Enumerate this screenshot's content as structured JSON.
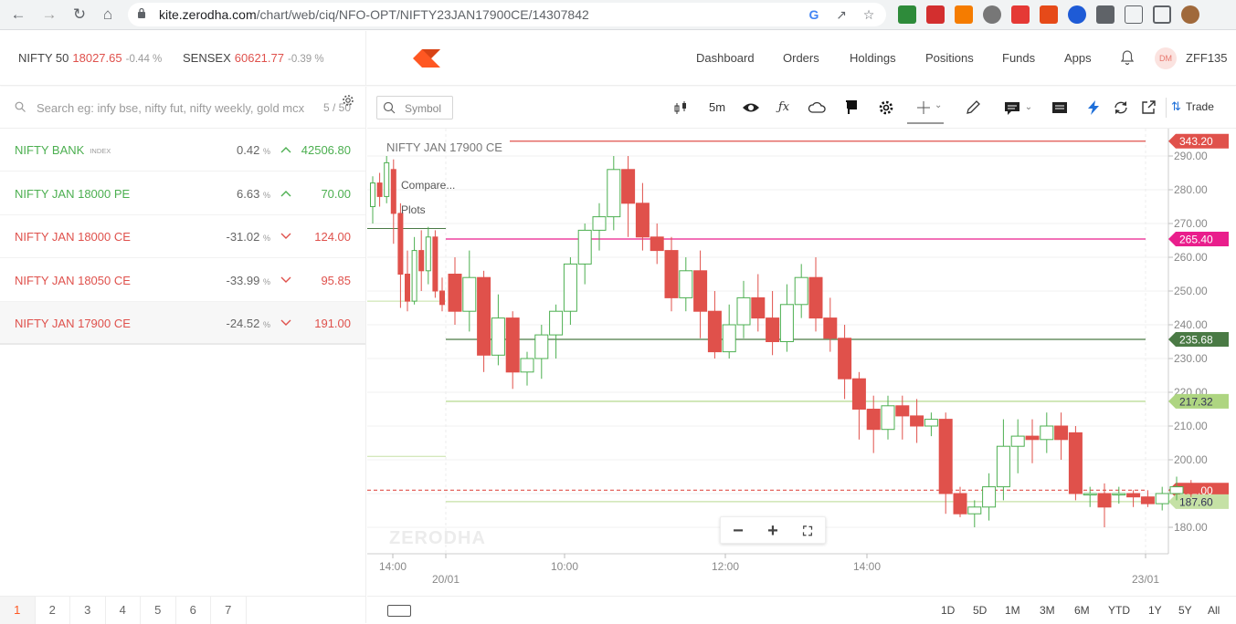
{
  "browser": {
    "url_host": "kite.zerodha.com",
    "url_path": "/chart/web/ciq/NFO-OPT/NIFTY23JAN17900CE/14307842"
  },
  "header": {
    "indices": [
      {
        "name": "NIFTY 50",
        "value": "18027.65",
        "change": "-0.44 %"
      },
      {
        "name": "SENSEX",
        "value": "60621.77",
        "change": "-0.39 %"
      }
    ],
    "nav": [
      "Dashboard",
      "Orders",
      "Holdings",
      "Positions",
      "Funds",
      "Apps"
    ],
    "avatar_initials": "DM",
    "user_id": "ZFF135"
  },
  "watchlist": {
    "search_placeholder": "Search eg: infy bse, nifty fut, nifty weekly, gold mcx",
    "count": "5 / 50",
    "items": [
      {
        "name": "NIFTY BANK",
        "tag": "INDEX",
        "pct": "0.42",
        "ltp": "42506.80",
        "dir": "up"
      },
      {
        "name": "NIFTY JAN 18000 PE",
        "tag": "",
        "pct": "6.63",
        "ltp": "70.00",
        "dir": "up"
      },
      {
        "name": "NIFTY JAN 18000 CE",
        "tag": "",
        "pct": "-31.02",
        "ltp": "124.00",
        "dir": "down"
      },
      {
        "name": "NIFTY JAN 18050 CE",
        "tag": "",
        "pct": "-33.99",
        "ltp": "95.85",
        "dir": "down"
      },
      {
        "name": "NIFTY JAN 17900 CE",
        "tag": "",
        "pct": "-24.52",
        "ltp": "191.00",
        "dir": "down"
      }
    ],
    "pct_unit": "%",
    "pages": [
      "1",
      "2",
      "3",
      "4",
      "5",
      "6",
      "7"
    ]
  },
  "chart": {
    "symbol_placeholder": "Symbol",
    "interval": "5m",
    "trade_label": "Trade",
    "title": "NIFTY JAN 17900 CE",
    "legend": [
      "Compare...",
      "Plots"
    ],
    "watermark": "ZERODHA",
    "ranges": [
      "1D",
      "5D",
      "1M",
      "3M",
      "6M",
      "YTD",
      "1Y",
      "5Y",
      "All"
    ],
    "colors": {
      "up": "#4caf50",
      "down": "#e0514b",
      "accent": "#ff5722"
    }
  },
  "chart_data": {
    "type": "candlestick",
    "title": "NIFTY JAN 17900 CE",
    "ylim": [
      175,
      296
    ],
    "y_ticks": [
      180,
      190,
      200,
      210,
      220,
      230,
      240,
      250,
      260,
      270,
      280,
      290
    ],
    "y_tick_labels": [
      "180.00",
      "190.00",
      "200.00",
      "210.00",
      "220.00",
      "230.00",
      "240.00",
      "250.00",
      "260.00",
      "270.00",
      "280.00",
      "290.00"
    ],
    "x_tick_labels": [
      "14:00",
      "20/01",
      "10:00",
      "12:00",
      "14:00",
      "23/01"
    ],
    "price_levels": [
      {
        "label": "343.20",
        "value": 294.4,
        "color": "#e0514b"
      },
      {
        "label": "265.40",
        "value": 265.4,
        "color": "#e91e8c"
      },
      {
        "label": "235.68",
        "value": 235.68,
        "color": "#4a7a45"
      },
      {
        "label": "217.32",
        "value": 217.32,
        "color": "#aed581"
      },
      {
        "label": "191.00",
        "value": 191.0,
        "color": "#e0514b"
      },
      {
        "label": "187.60",
        "value": 187.6,
        "color": "#c5e1a5"
      }
    ],
    "candles_session1": [
      [
        275,
        282,
        270,
        284
      ],
      [
        282,
        278,
        275,
        285
      ],
      [
        278,
        288,
        276,
        290
      ],
      [
        286,
        273,
        264,
        289
      ],
      [
        273,
        255,
        245,
        276
      ],
      [
        255,
        247,
        244,
        262
      ],
      [
        247,
        262,
        246,
        266
      ],
      [
        262,
        256,
        250,
        268
      ],
      [
        256,
        266,
        252,
        269
      ],
      [
        266,
        250,
        248,
        268
      ],
      [
        250,
        246,
        244,
        254
      ]
    ],
    "candles_session2": [
      [
        255,
        244,
        240,
        260
      ],
      [
        244,
        254,
        238,
        262
      ],
      [
        254,
        231,
        226,
        256
      ],
      [
        231,
        242,
        228,
        249
      ],
      [
        242,
        226,
        221,
        244
      ],
      [
        226,
        230,
        222,
        232
      ],
      [
        230,
        237,
        224,
        240
      ],
      [
        237,
        244,
        230,
        246
      ],
      [
        244,
        258,
        240,
        260
      ],
      [
        258,
        268,
        252,
        270
      ],
      [
        268,
        272,
        262,
        276
      ],
      [
        272,
        286,
        268,
        290
      ],
      [
        286,
        276,
        266,
        290
      ],
      [
        276,
        266,
        262,
        282
      ],
      [
        266,
        262,
        258,
        270
      ],
      [
        262,
        248,
        244,
        266
      ],
      [
        248,
        256,
        244,
        260
      ],
      [
        256,
        244,
        236,
        262
      ],
      [
        244,
        232,
        230,
        250
      ],
      [
        232,
        240,
        230,
        246
      ],
      [
        240,
        248,
        236,
        253
      ],
      [
        248,
        242,
        238,
        255
      ],
      [
        242,
        235,
        231,
        250
      ],
      [
        235,
        246,
        232,
        252
      ],
      [
        246,
        254,
        242,
        258
      ],
      [
        254,
        242,
        238,
        260
      ],
      [
        242,
        236,
        232,
        248
      ],
      [
        236,
        224,
        218,
        240
      ],
      [
        224,
        215,
        206,
        226
      ],
      [
        215,
        209,
        202,
        219
      ],
      [
        209,
        216,
        206,
        219
      ],
      [
        216,
        213,
        206,
        219
      ],
      [
        213,
        210,
        205,
        218
      ],
      [
        210,
        212,
        207,
        214
      ],
      [
        212,
        190,
        184,
        214
      ],
      [
        190,
        184,
        183,
        192
      ],
      [
        184,
        186,
        180,
        188
      ],
      [
        186,
        192,
        182,
        196
      ],
      [
        192,
        204,
        188,
        212
      ],
      [
        204,
        207,
        196,
        212
      ],
      [
        207,
        206,
        199,
        212
      ],
      [
        206,
        210,
        202,
        214
      ],
      [
        210,
        206,
        200,
        214
      ],
      [
        208,
        190,
        188,
        210
      ],
      [
        190,
        190,
        186,
        192
      ],
      [
        190,
        186,
        180,
        193
      ],
      [
        190,
        190,
        187,
        192
      ],
      [
        190,
        189,
        186,
        191
      ],
      [
        189,
        187,
        186,
        191
      ],
      [
        187,
        190,
        185,
        192
      ],
      [
        190,
        192,
        188,
        195
      ],
      [
        192,
        190,
        189,
        194
      ]
    ]
  }
}
